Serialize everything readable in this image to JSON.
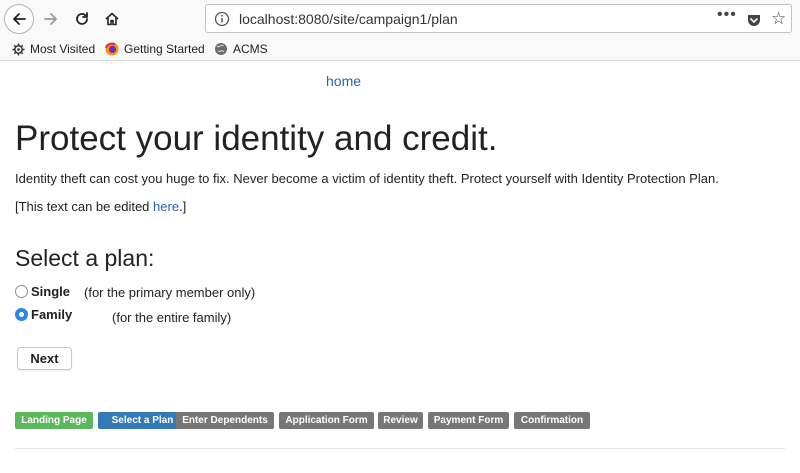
{
  "browser": {
    "url": "localhost:8080/site/campaign1/plan",
    "url_menu": "•••",
    "bookmarks": [
      {
        "label": "Most Visited",
        "icon": "gear-icon"
      },
      {
        "label": "Getting Started",
        "icon": "firefox-icon"
      },
      {
        "label": "ACMS",
        "icon": "globe-icon"
      }
    ]
  },
  "page": {
    "home_link": "home",
    "title": "Protect your identity and credit.",
    "description": "Identity theft can cost you huge to fix. Never become a victim of identity theft. Protect yourself with Identity Protection Plan.",
    "edit_note_prefix": "[This text can be edited ",
    "edit_note_link": "here",
    "edit_note_suffix": ".]",
    "select_title": "Select a plan:",
    "plans": [
      {
        "label": "Single",
        "description": "(for the primary member only)",
        "selected": false
      },
      {
        "label": "Family",
        "description": "(for the entire family)",
        "selected": true
      }
    ],
    "next_label": "Next"
  },
  "steps": [
    {
      "label": "Landing Page",
      "status": "done",
      "color": "#5cb85c"
    },
    {
      "label": "Select a Plan",
      "status": "current",
      "color": "#337ab7"
    },
    {
      "label": "Enter Dependents",
      "status": "todo",
      "color": "#777777"
    },
    {
      "label": "Application Form",
      "status": "todo",
      "color": "#777777"
    },
    {
      "label": "Review",
      "status": "todo",
      "color": "#777777"
    },
    {
      "label": "Payment Form",
      "status": "todo",
      "color": "#777777"
    },
    {
      "label": "Confirmation",
      "status": "todo",
      "color": "#777777"
    }
  ]
}
